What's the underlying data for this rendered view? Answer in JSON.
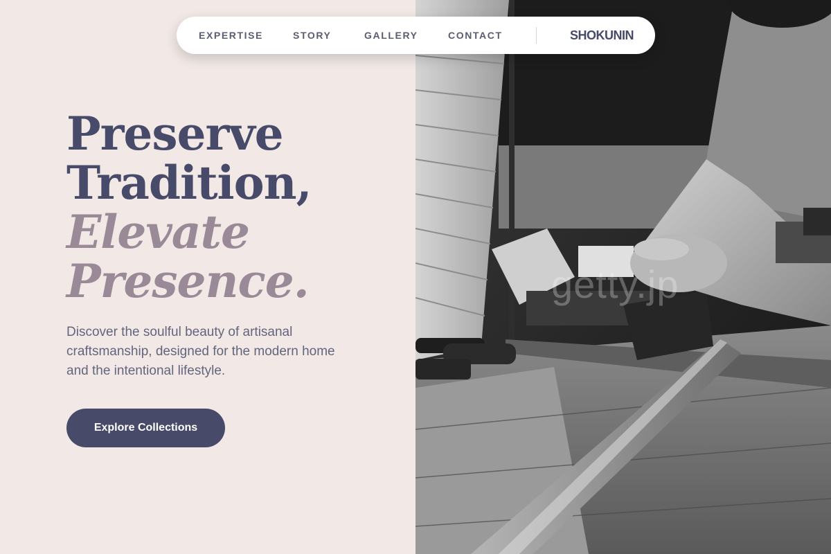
{
  "nav": {
    "items": [
      {
        "label": "EXPERTISE"
      },
      {
        "label": "STORY"
      },
      {
        "label": "GALLERY"
      },
      {
        "label": "CONTACT"
      }
    ],
    "brand": "SHOKUNIN"
  },
  "hero": {
    "headline_line1": "Preserve",
    "headline_line2": "Tradition,",
    "headline_line3": "Elevate",
    "headline_line4": "Presence.",
    "description": "Discover the soulful beauty of artisanal craftsmanship, designed for the modern home and the intentional lifestyle.",
    "cta_label": "Explore Collections"
  },
  "photo": {
    "watermark": "getty.jp"
  },
  "colors": {
    "background": "#f2e9e6",
    "primary": "#474a68",
    "muted_accent": "#9a8a97",
    "body_text": "#62657d"
  }
}
